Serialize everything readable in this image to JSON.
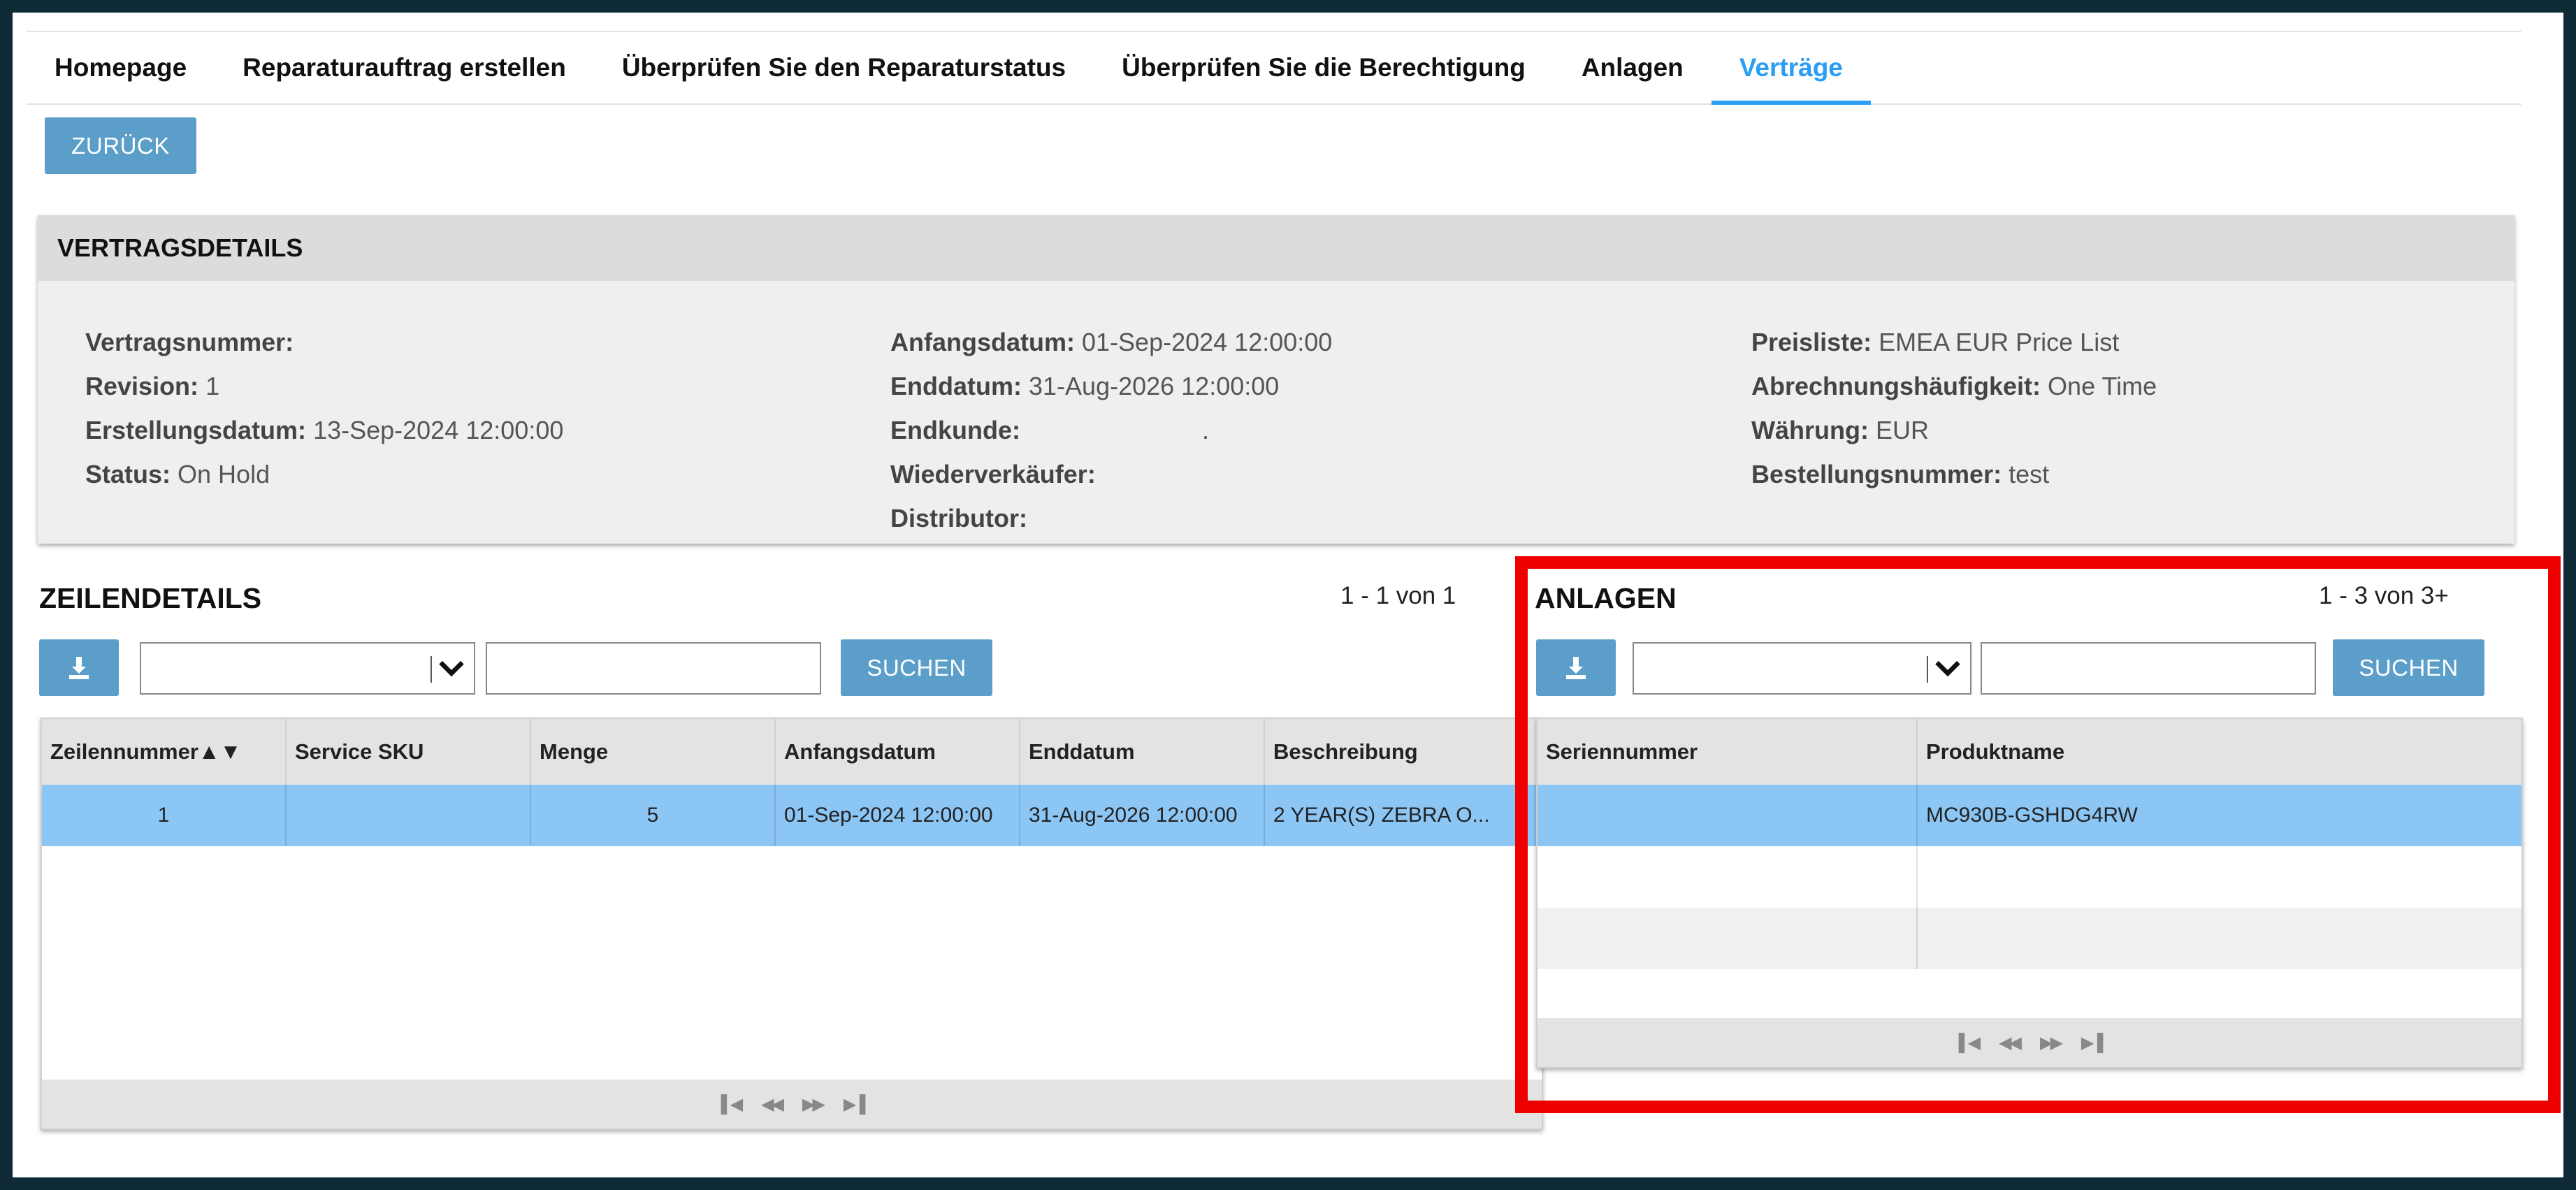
{
  "nav": {
    "items": [
      {
        "label": "Homepage"
      },
      {
        "label": "Reparaturauftrag erstellen"
      },
      {
        "label": "Überprüfen Sie den Reparaturstatus"
      },
      {
        "label": "Überprüfen Sie die Berechtigung"
      },
      {
        "label": "Anlagen"
      },
      {
        "label": "Verträge"
      }
    ],
    "active": "Verträge"
  },
  "back_button": "ZURÜCK",
  "details": {
    "title": "VERTRAGSDETAILS",
    "col1": [
      {
        "label": "Vertragsnummer:",
        "value": ""
      },
      {
        "label": "Revision:",
        "value": "1"
      },
      {
        "label": "Erstellungsdatum:",
        "value": "13-Sep-2024 12:00:00"
      },
      {
        "label": "Status:",
        "value": "On Hold"
      }
    ],
    "col2": [
      {
        "label": "Anfangsdatum:",
        "value": "01-Sep-2024 12:00:00"
      },
      {
        "label": "Enddatum:",
        "value": "31-Aug-2026 12:00:00"
      },
      {
        "label": "Endkunde:",
        "value": "."
      },
      {
        "label": "Wiederverkäufer:",
        "value": ""
      },
      {
        "label": "Distributor:",
        "value": ""
      }
    ],
    "col3": [
      {
        "label": "Preisliste:",
        "value": "EMEA EUR Price List"
      },
      {
        "label": "Abrechnungshäufigkeit:",
        "value": "One Time"
      },
      {
        "label": "Währung:",
        "value": "EUR"
      },
      {
        "label": "Bestellungsnummer:",
        "value": "test"
      }
    ]
  },
  "lines": {
    "title": "ZEILENDETAILS",
    "pager": "1 - 1 von 1",
    "search_label": "SUCHEN",
    "columns": [
      "Zeilennummer",
      "Service SKU",
      "Menge",
      "Anfangsdatum",
      "Enddatum",
      "Beschreibung"
    ],
    "sort_indicator": "▲▼",
    "rows": [
      [
        "1",
        "",
        "5",
        "01-Sep-2024 12:00:00",
        "31-Aug-2026 12:00:00",
        "2 YEAR(S) ZEBRA O..."
      ]
    ]
  },
  "assets": {
    "title": "ANLAGEN",
    "pager": "1 - 3 von 3+",
    "search_label": "SUCHEN",
    "columns": [
      "Seriennummer",
      "Produktname"
    ],
    "rows": [
      [
        "",
        "MC930B-GSHDG4RW"
      ],
      [
        "",
        ""
      ],
      [
        "",
        ""
      ]
    ]
  },
  "colors": {
    "accent": "#2a9df4",
    "button": "#5b9ec9",
    "selected_row": "#8cc6f5",
    "highlight": "#ee0000"
  }
}
